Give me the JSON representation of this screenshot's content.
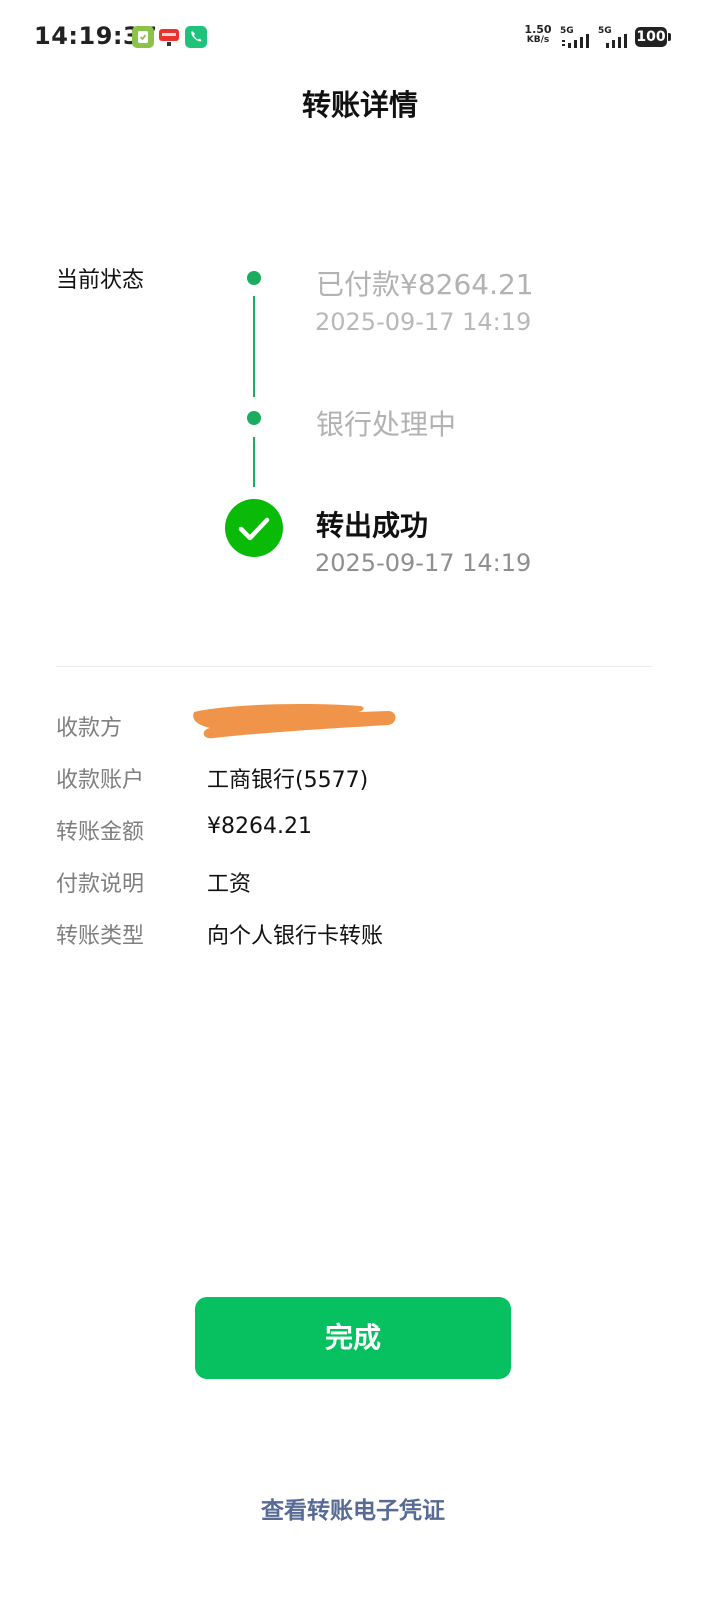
{
  "status_bar": {
    "time": "14:19:37",
    "net_speed_value": "1.50",
    "net_speed_unit": "KB/s",
    "signal1_label": "5G",
    "signal2_label": "5G",
    "battery": "100",
    "notification_icons": [
      "task-app-icon",
      "shopping-app-icon",
      "phone-app-icon"
    ]
  },
  "header": {
    "title": "转账详情"
  },
  "status": {
    "label": "当前状态",
    "steps": [
      {
        "title": "已付款¥8264.21",
        "time": "2025-09-17 14:19",
        "state": "done-muted"
      },
      {
        "title": "银行处理中",
        "state": "done-muted"
      },
      {
        "title": "转出成功",
        "time": "2025-09-17 14:19",
        "state": "current-success"
      }
    ]
  },
  "details": {
    "rows": [
      {
        "label": "收款方",
        "value": ""
      },
      {
        "label": "收款账户",
        "value": "工商银行(5577)"
      },
      {
        "label": "转账金额",
        "value": "¥8264.21"
      },
      {
        "label": "付款说明",
        "value": "工资"
      },
      {
        "label": "转账类型",
        "value": "向个人银行卡转账"
      }
    ]
  },
  "actions": {
    "done_label": "完成",
    "voucher_link": "查看转账电子凭证"
  },
  "colors": {
    "accent_green": "#07c160",
    "timeline_green": "#1aad5f",
    "link_blue": "#576b95",
    "redaction_orange": "#f0944a"
  }
}
